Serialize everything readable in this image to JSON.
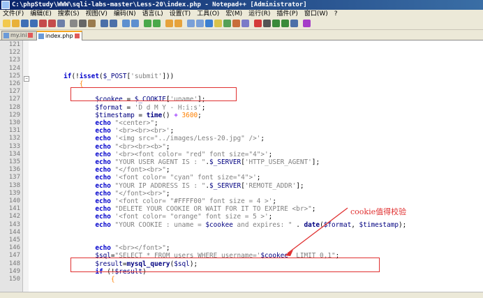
{
  "window": {
    "title": "C:\\phpStudy\\WWW\\sqli-labs-master\\Less-20\\index.php - Notepad++ [Administrator]"
  },
  "menu": [
    "文件(F)",
    "编辑(E)",
    "搜索(S)",
    "视图(V)",
    "编码(N)",
    "语言(L)",
    "设置(T)",
    "工具(O)",
    "宏(M)",
    "运行(R)",
    "插件(P)",
    "窗口(W)",
    "?"
  ],
  "tabs": [
    {
      "label": "my.ini",
      "active": false
    },
    {
      "label": "index.php",
      "active": true
    }
  ],
  "annotation": {
    "text": "cookie值得校验",
    "color": "#e03030"
  },
  "lines": [
    {
      "n": "121",
      "t": []
    },
    {
      "n": "122",
      "t": []
    },
    {
      "n": "123",
      "t": []
    },
    {
      "n": "124",
      "t": []
    },
    {
      "n": "125",
      "t": [
        {
          "c": "",
          "s": "        "
        },
        {
          "c": "kw",
          "s": "if"
        },
        {
          "c": "",
          "s": "(!"
        },
        {
          "c": "kw",
          "s": "isset"
        },
        {
          "c": "",
          "s": "("
        },
        {
          "c": "var",
          "s": "$_POST"
        },
        {
          "c": "",
          "s": "["
        },
        {
          "c": "str",
          "s": "'submit'"
        },
        {
          "c": "",
          "s": "]))"
        }
      ]
    },
    {
      "n": "126",
      "t": [
        {
          "c": "",
          "s": "            "
        },
        {
          "c": "ob",
          "s": "{"
        }
      ]
    },
    {
      "n": "127",
      "t": []
    },
    {
      "n": "127",
      "t": [
        {
          "c": "",
          "s": "                "
        },
        {
          "c": "var",
          "s": "$cookee"
        },
        {
          "c": "",
          "s": " = "
        },
        {
          "c": "var",
          "s": "$_COOKIE"
        },
        {
          "c": "",
          "s": "["
        },
        {
          "c": "str",
          "s": "'uname'"
        },
        {
          "c": "",
          "s": "];"
        }
      ]
    },
    {
      "n": "128",
      "t": [
        {
          "c": "",
          "s": "                "
        },
        {
          "c": "var",
          "s": "$format"
        },
        {
          "c": "",
          "s": " = "
        },
        {
          "c": "str",
          "s": "'D d M Y - H:i:s'"
        },
        {
          "c": "",
          "s": ";"
        }
      ]
    },
    {
      "n": "129",
      "t": [
        {
          "c": "",
          "s": "                "
        },
        {
          "c": "var",
          "s": "$timestamp"
        },
        {
          "c": "",
          "s": " = "
        },
        {
          "c": "fn",
          "s": "time"
        },
        {
          "c": "",
          "s": "() "
        },
        {
          "c": "op",
          "s": "+"
        },
        {
          "c": "",
          "s": " "
        },
        {
          "c": "num",
          "s": "3600"
        },
        {
          "c": "",
          "s": ";"
        }
      ]
    },
    {
      "n": "130",
      "t": [
        {
          "c": "",
          "s": "                "
        },
        {
          "c": "kw",
          "s": "echo"
        },
        {
          "c": "",
          "s": " "
        },
        {
          "c": "str",
          "s": "\"<center>\""
        },
        {
          "c": "",
          "s": ";"
        }
      ]
    },
    {
      "n": "131",
      "t": [
        {
          "c": "",
          "s": "                "
        },
        {
          "c": "kw",
          "s": "echo"
        },
        {
          "c": "",
          "s": " "
        },
        {
          "c": "str",
          "s": "'<br><br><br>'"
        },
        {
          "c": "",
          "s": ";"
        }
      ]
    },
    {
      "n": "132",
      "t": [
        {
          "c": "",
          "s": "                "
        },
        {
          "c": "kw",
          "s": "echo"
        },
        {
          "c": "",
          "s": " "
        },
        {
          "c": "str",
          "s": "'<img src=\"../images/Less-20.jpg\" />'"
        },
        {
          "c": "",
          "s": ";"
        }
      ]
    },
    {
      "n": "133",
      "t": [
        {
          "c": "",
          "s": "                "
        },
        {
          "c": "kw",
          "s": "echo"
        },
        {
          "c": "",
          "s": " "
        },
        {
          "c": "str",
          "s": "\"<br><br><b>\""
        },
        {
          "c": "",
          "s": ";"
        }
      ]
    },
    {
      "n": "134",
      "t": [
        {
          "c": "",
          "s": "                "
        },
        {
          "c": "kw",
          "s": "echo"
        },
        {
          "c": "",
          "s": " "
        },
        {
          "c": "str",
          "s": "'<br><font color= \"red\" font size=\"4\">'"
        },
        {
          "c": "",
          "s": ";"
        }
      ]
    },
    {
      "n": "135",
      "t": [
        {
          "c": "",
          "s": "                "
        },
        {
          "c": "kw",
          "s": "echo"
        },
        {
          "c": "",
          "s": " "
        },
        {
          "c": "str",
          "s": "\"YOUR USER AGENT IS : \""
        },
        {
          "c": "",
          "s": "."
        },
        {
          "c": "var",
          "s": "$_SERVER"
        },
        {
          "c": "",
          "s": "["
        },
        {
          "c": "str",
          "s": "'HTTP_USER_AGENT'"
        },
        {
          "c": "",
          "s": "];"
        }
      ]
    },
    {
      "n": "136",
      "t": [
        {
          "c": "",
          "s": "                "
        },
        {
          "c": "kw",
          "s": "echo"
        },
        {
          "c": "",
          "s": " "
        },
        {
          "c": "str",
          "s": "\"</font><br>\""
        },
        {
          "c": "",
          "s": ";"
        }
      ]
    },
    {
      "n": "137",
      "t": [
        {
          "c": "",
          "s": "                "
        },
        {
          "c": "kw",
          "s": "echo"
        },
        {
          "c": "",
          "s": " "
        },
        {
          "c": "str",
          "s": "'<font color= \"cyan\" font size=\"4\">'"
        },
        {
          "c": "",
          "s": ";"
        }
      ]
    },
    {
      "n": "138",
      "t": [
        {
          "c": "",
          "s": "                "
        },
        {
          "c": "kw",
          "s": "echo"
        },
        {
          "c": "",
          "s": " "
        },
        {
          "c": "str",
          "s": "\"YOUR IP ADDRESS IS : \""
        },
        {
          "c": "",
          "s": "."
        },
        {
          "c": "var",
          "s": "$_SERVER"
        },
        {
          "c": "",
          "s": "["
        },
        {
          "c": "str",
          "s": "'REMOTE_ADDR'"
        },
        {
          "c": "",
          "s": "];"
        }
      ]
    },
    {
      "n": "139",
      "t": [
        {
          "c": "",
          "s": "                "
        },
        {
          "c": "kw",
          "s": "echo"
        },
        {
          "c": "",
          "s": " "
        },
        {
          "c": "str",
          "s": "\"</font><br>\""
        },
        {
          "c": "",
          "s": ";"
        }
      ]
    },
    {
      "n": "140",
      "t": [
        {
          "c": "",
          "s": "                "
        },
        {
          "c": "kw",
          "s": "echo"
        },
        {
          "c": "",
          "s": " "
        },
        {
          "c": "str",
          "s": "'<font color= \"#FFFF00\" font size = 4 >'"
        },
        {
          "c": "",
          "s": ";"
        }
      ]
    },
    {
      "n": "141",
      "t": [
        {
          "c": "",
          "s": "                "
        },
        {
          "c": "kw",
          "s": "echo"
        },
        {
          "c": "",
          "s": " "
        },
        {
          "c": "str",
          "s": "\"DELETE YOUR COOKIE OR WAIT FOR IT TO EXPIRE <br>\""
        },
        {
          "c": "",
          "s": ";"
        }
      ]
    },
    {
      "n": "142",
      "t": [
        {
          "c": "",
          "s": "                "
        },
        {
          "c": "kw",
          "s": "echo"
        },
        {
          "c": "",
          "s": " "
        },
        {
          "c": "str",
          "s": "'<font color= \"orange\" font size = 5 >'"
        },
        {
          "c": "",
          "s": ";"
        }
      ]
    },
    {
      "n": "143",
      "t": [
        {
          "c": "",
          "s": "                "
        },
        {
          "c": "kw",
          "s": "echo"
        },
        {
          "c": "",
          "s": " "
        },
        {
          "c": "str",
          "s": "\"YOUR COOKIE : uname = "
        },
        {
          "c": "var",
          "s": "$cookee"
        },
        {
          "c": "str",
          "s": " and expires: \""
        },
        {
          "c": "",
          "s": " . "
        },
        {
          "c": "fn",
          "s": "date"
        },
        {
          "c": "",
          "s": "("
        },
        {
          "c": "var",
          "s": "$format"
        },
        {
          "c": "",
          "s": ", "
        },
        {
          "c": "var",
          "s": "$timestamp"
        },
        {
          "c": "",
          "s": ");"
        }
      ]
    },
    {
      "n": "144",
      "t": []
    },
    {
      "n": "145",
      "t": []
    },
    {
      "n": "146",
      "t": [
        {
          "c": "",
          "s": "                "
        },
        {
          "c": "kw",
          "s": "echo"
        },
        {
          "c": "",
          "s": " "
        },
        {
          "c": "str",
          "s": "\"<br></font>\""
        },
        {
          "c": "",
          "s": ";"
        }
      ]
    },
    {
      "n": "147",
      "t": [
        {
          "c": "",
          "s": "                "
        },
        {
          "c": "var",
          "s": "$sql"
        },
        {
          "c": "",
          "s": "="
        },
        {
          "c": "str",
          "s": "\"SELECT * FROM users WHERE username='"
        },
        {
          "c": "var",
          "s": "$cookee"
        },
        {
          "c": "str",
          "s": "' LIMIT 0,1\""
        },
        {
          "c": "",
          "s": ";"
        }
      ]
    },
    {
      "n": "148",
      "t": [
        {
          "c": "",
          "s": "                "
        },
        {
          "c": "var",
          "s": "$result"
        },
        {
          "c": "",
          "s": "="
        },
        {
          "c": "fn",
          "s": "mysql_query"
        },
        {
          "c": "",
          "s": "("
        },
        {
          "c": "var",
          "s": "$sql"
        },
        {
          "c": "",
          "s": ");"
        }
      ]
    },
    {
      "n": "149",
      "t": [
        {
          "c": "",
          "s": "                "
        },
        {
          "c": "kw",
          "s": "if"
        },
        {
          "c": "",
          "s": " (!"
        },
        {
          "c": "var",
          "s": "$result"
        },
        {
          "c": "",
          "s": ")"
        }
      ]
    },
    {
      "n": "150",
      "t": [
        {
          "c": "",
          "s": "                    "
        },
        {
          "c": "ob",
          "s": "{"
        }
      ]
    }
  ]
}
